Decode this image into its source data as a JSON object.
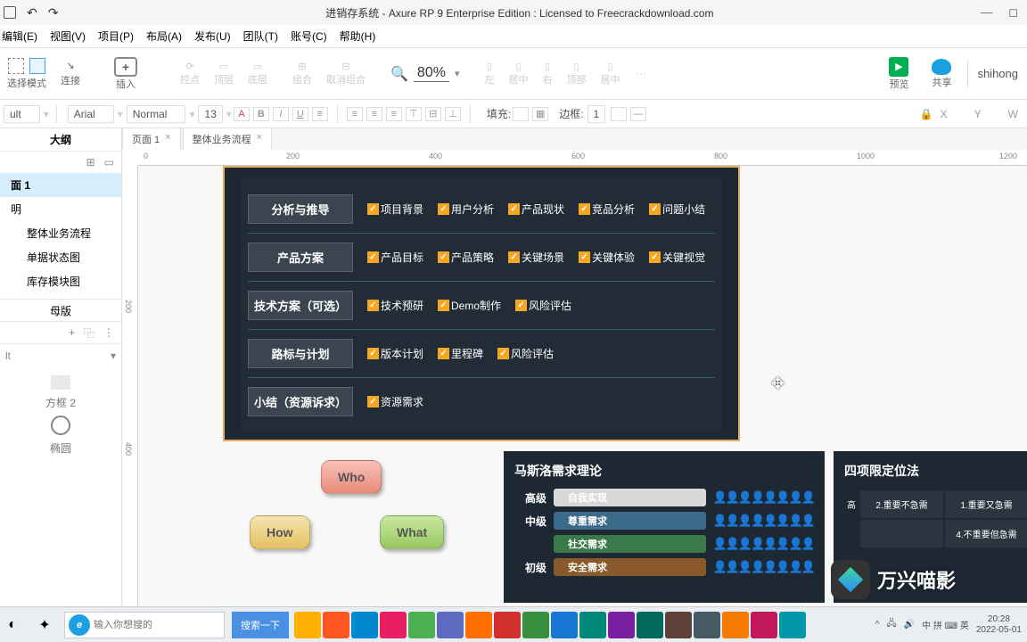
{
  "titlebar": {
    "title": "进销存系统 - Axure RP 9 Enterprise Edition : Licensed to Freecrackdownload.com"
  },
  "menu": {
    "edit": "编辑(E)",
    "view": "视图(V)",
    "project": "项目(P)",
    "layout": "布局(A)",
    "publish": "发布(U)",
    "team": "团队(T)",
    "account": "账号(C)",
    "help": "帮助(H)"
  },
  "toolbar": {
    "select_label": "选择模式",
    "connect_label": "连接",
    "insert_label": "插入",
    "point_label": "控点",
    "top_label": "顶层",
    "bottom_label": "底层",
    "group_label": "组合",
    "ungroup_label": "取消组合",
    "zoom_value": "80%",
    "left_label": "左",
    "center_label": "居中",
    "right_label": "右",
    "topa_label": "顶部",
    "mid_label": "居中",
    "preview_label": "预览",
    "share_label": "共享",
    "user": "shihong"
  },
  "propbar": {
    "default": "ult",
    "font": "Arial",
    "weight": "Normal",
    "size": "13",
    "fill_label": "填充:",
    "border_label": "边框:",
    "border_val": "1",
    "x": "X",
    "y": "Y",
    "w": "W"
  },
  "sidebar": {
    "outline": "大纲",
    "items": [
      {
        "label": "面 1",
        "sel": true
      },
      {
        "label": "明"
      },
      {
        "label": "整体业务流程",
        "child": true
      },
      {
        "label": "单据状态图",
        "child": true
      },
      {
        "label": "库存模块图",
        "child": true
      }
    ],
    "master": "母版",
    "search_ph": "lt",
    "shape1": "方框 2",
    "shape2": "椭圆"
  },
  "tabs": {
    "tab1": "页面 1",
    "tab2": "整体业务流程"
  },
  "ruler_h": [
    "0",
    "200",
    "400",
    "600",
    "800",
    "1000",
    "1200"
  ],
  "ruler_v": [
    "200",
    "400"
  ],
  "dark": {
    "rows": [
      {
        "label": "分析与推导",
        "items": [
          "项目背景",
          "用户分析",
          "产品现状",
          "竞品分析",
          "问题小结"
        ]
      },
      {
        "label": "产品方案",
        "items": [
          "产品目标",
          "产品策略",
          "关键场景",
          "关键体验",
          "关键视觉"
        ]
      },
      {
        "label": "技术方案（可选）",
        "items": [
          "技术预研",
          "Demo制作",
          "风险评估"
        ]
      },
      {
        "label": "路标与计划",
        "items": [
          "版本计划",
          "里程碑",
          "风险评估"
        ]
      },
      {
        "label": "小结（资源诉求）",
        "items": [
          "资源需求"
        ]
      }
    ]
  },
  "bubbles": {
    "who": "Who",
    "how": "How",
    "what": "What"
  },
  "maslow": {
    "title": "马斯洛需求理论",
    "rows": [
      {
        "lvl": "高级",
        "pill": "自我实现",
        "color": "#3fa0e8",
        "bg": "#d8d8d8"
      },
      {
        "lvl": "中级",
        "pill": "尊重需求",
        "color": "#3fa0e8",
        "bg": "#3a6a8a"
      },
      {
        "lvl": "",
        "pill": "社交需求",
        "color": "#5ab85a",
        "bg": "#3a7a4a"
      },
      {
        "lvl": "初级",
        "pill": "安全需求",
        "color": "#e89a3a",
        "bg": "#8a5a2a"
      }
    ]
  },
  "quad": {
    "title": "四项限定位法",
    "cells": {
      "c1": "2.重要不急需",
      "c2": "1.重要又急需",
      "c3": "",
      "c4": "4.不重要但急需",
      "ylabel": "高"
    }
  },
  "taskbar": {
    "search_ph": "输入你想搜的",
    "search_btn": "搜索一下",
    "tray": {
      "ime": "中 拼 ⌨ 英",
      "time": "20:28",
      "date": "2022-05-01"
    }
  },
  "watermark": "万兴喵影"
}
